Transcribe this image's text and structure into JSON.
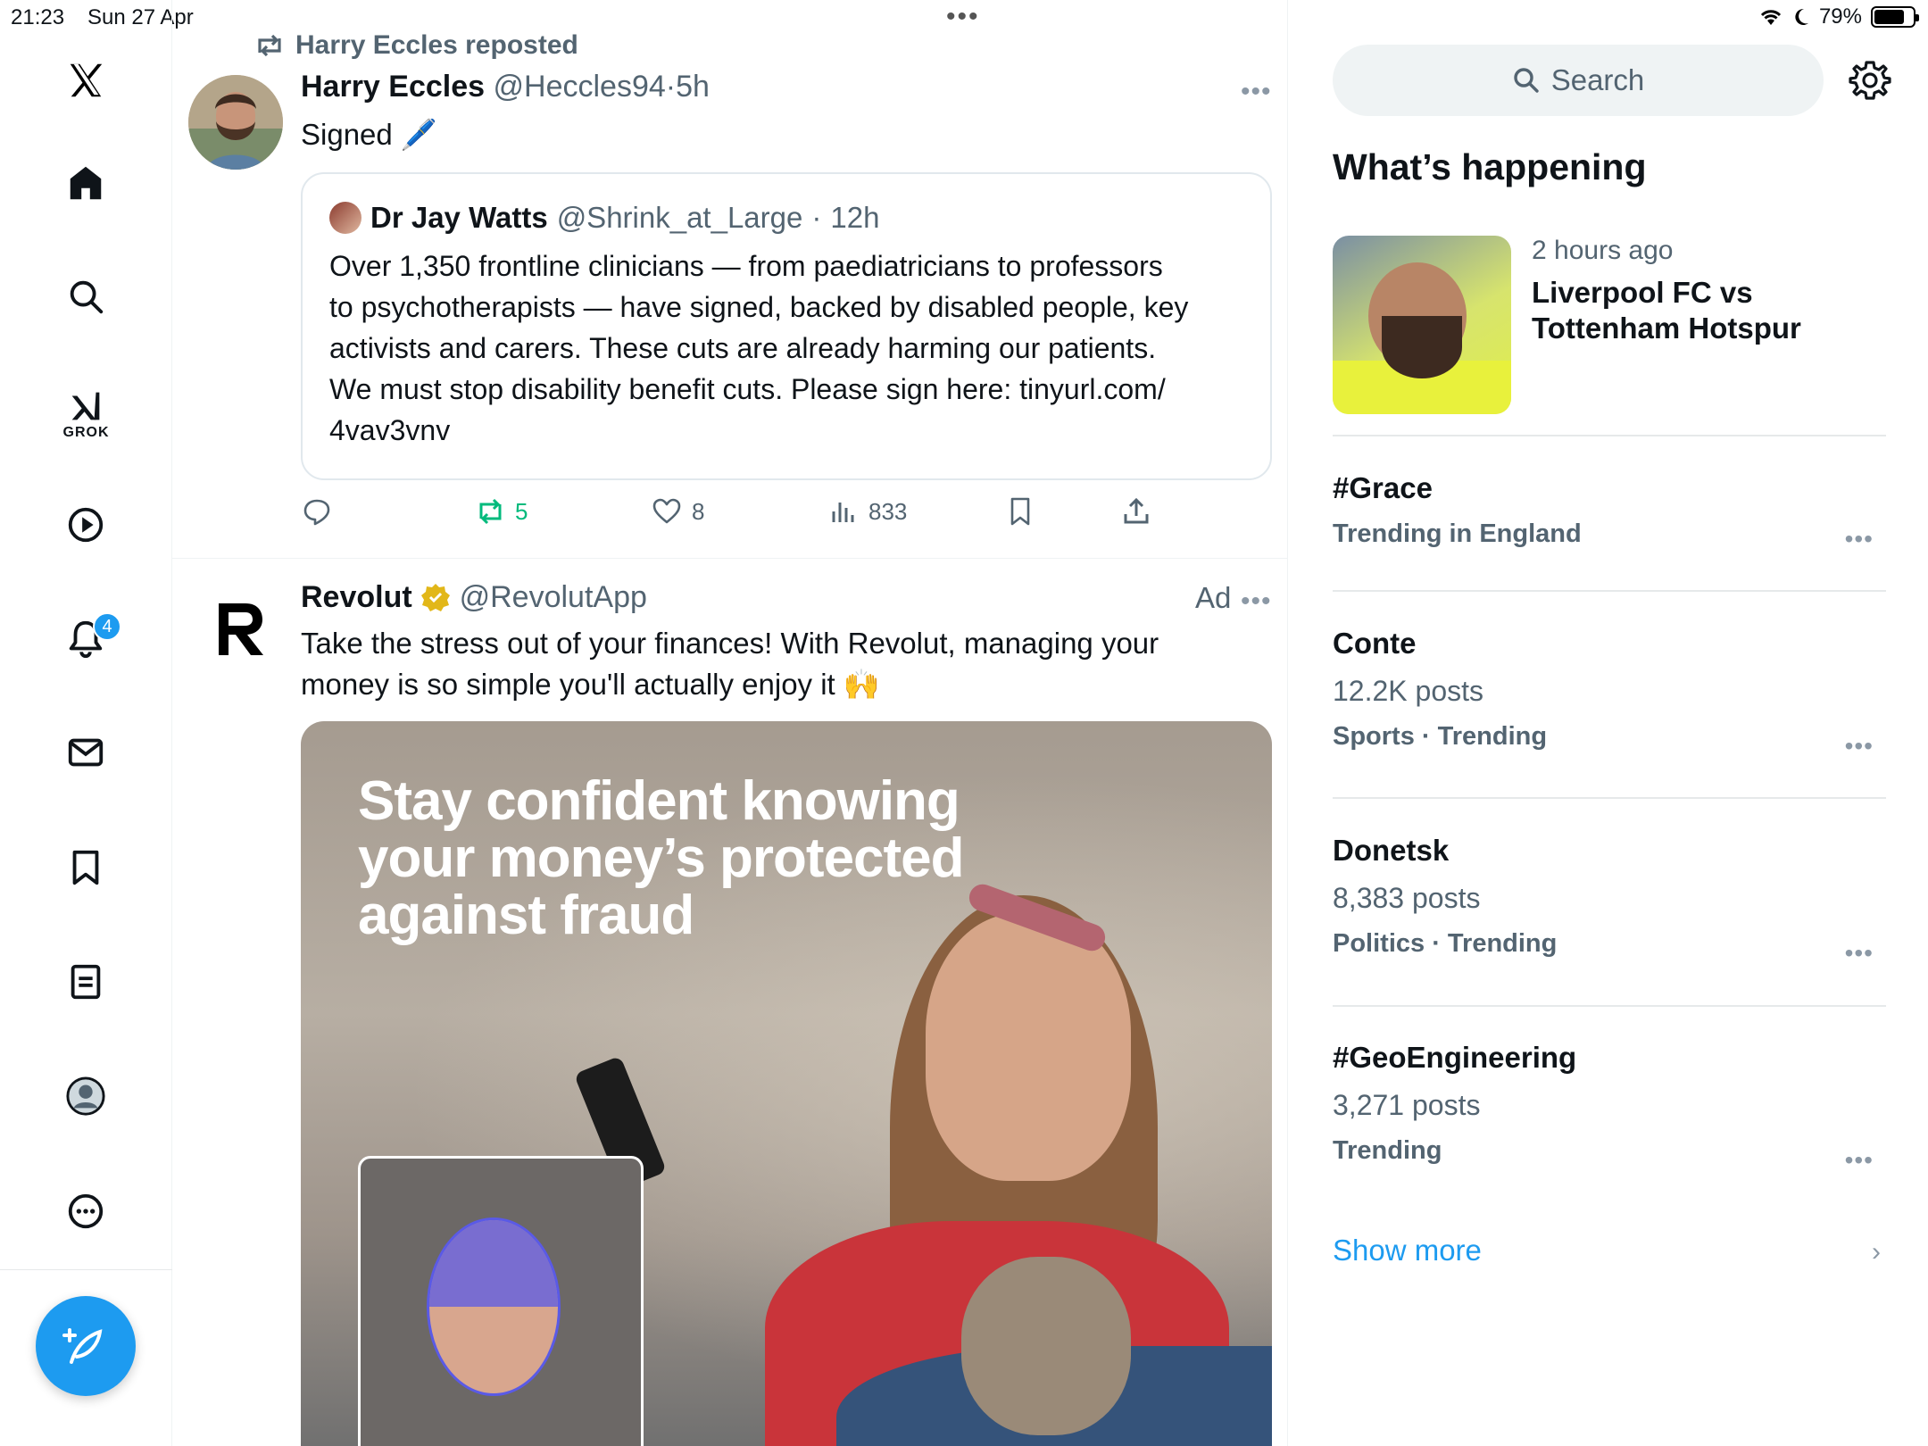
{
  "status_bar": {
    "time": "21:23",
    "date": "Sun 27 Apr",
    "battery": "79%",
    "battery_level": 0.79
  },
  "nav": {
    "items": [
      {
        "name": "x-logo-icon"
      },
      {
        "name": "home-icon"
      },
      {
        "name": "explore-icon"
      },
      {
        "name": "grok-icon",
        "label": "GROK"
      },
      {
        "name": "video-icon"
      },
      {
        "name": "notifications-icon",
        "badge": "4"
      },
      {
        "name": "messages-icon"
      },
      {
        "name": "bookmarks-icon"
      },
      {
        "name": "lists-icon"
      },
      {
        "name": "profile-icon"
      },
      {
        "name": "more-icon"
      }
    ],
    "compose_icon": "compose-feather-icon"
  },
  "feed": {
    "post1": {
      "repost_label": "Harry Eccles reposted",
      "author_name": "Harry Eccles",
      "author_handle": "@Heccles94",
      "time": "5h",
      "text": "Signed 🖊️",
      "quote": {
        "author_name": "Dr Jay Watts",
        "author_handle": "@Shrink_at_Large",
        "time": "12h",
        "lines": [
          "Over 1,350 frontline clinicians — from paediatricians to professors",
          "to psychotherapists — have signed, backed by disabled people, key",
          "activists and carers. These cuts are already harming our patients.",
          "We must stop disability benefit cuts. Please sign here: tinyurl.com/",
          "4vav3vnv"
        ]
      },
      "actions": {
        "reposts": "5",
        "likes": "8",
        "views": "833"
      }
    },
    "post2": {
      "author_name": "Revolut",
      "author_handle": "@RevolutApp",
      "ad_label": "Ad",
      "line1": "Take the stress out of your finances! With Revolut, managing your",
      "line2": "money is so simple you'll actually enjoy it 🙌",
      "media_headline": [
        "Stay confident knowing",
        "your money’s protected",
        "against fraud"
      ]
    }
  },
  "sidebar": {
    "search_placeholder": "Search",
    "section_title": "What’s happening",
    "news": {
      "time": "2 hours ago",
      "title": "Liverpool FC vs Tottenham Hotspur"
    },
    "trends": [
      {
        "name": "#Grace",
        "posts": "",
        "context": "Trending in England"
      },
      {
        "name": "Conte",
        "posts": "12.2K posts",
        "context": "Sports · Trending"
      },
      {
        "name": "Donetsk",
        "posts": "8,383 posts",
        "context": "Politics · Trending"
      },
      {
        "name": "#GeoEngineering",
        "posts": "3,271 posts",
        "context": "Trending"
      }
    ],
    "show_more": "Show more"
  },
  "colors": {
    "accent": "#1d9bf0",
    "repost_green": "#00ba7c",
    "muted_text": "#536471"
  }
}
